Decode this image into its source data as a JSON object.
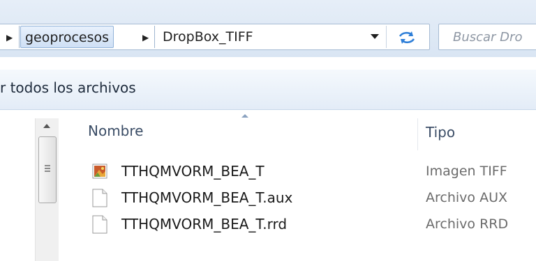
{
  "address_bar": {
    "breadcrumbs": [
      "geoprocesos",
      "DropBox_TIFF"
    ]
  },
  "search": {
    "placeholder": "Buscar Dro"
  },
  "command_bar": {
    "label": "r todos los archivos"
  },
  "columns": {
    "name": "Nombre",
    "type": "Tipo"
  },
  "files": [
    {
      "name": "TTHQMVORM_BEA_T",
      "type": "Imagen TIFF",
      "icon": "tiff-image-icon"
    },
    {
      "name": "TTHQMVORM_BEA_T.aux",
      "type": "Archivo AUX",
      "icon": "document-icon"
    },
    {
      "name": "TTHQMVORM_BEA_T.rrd",
      "type": "Archivo RRD",
      "icon": "document-icon"
    }
  ],
  "colors": {
    "chrome": "#dce7f4",
    "accent": "#1e6fd1",
    "text_secondary": "#6b6b6b"
  }
}
